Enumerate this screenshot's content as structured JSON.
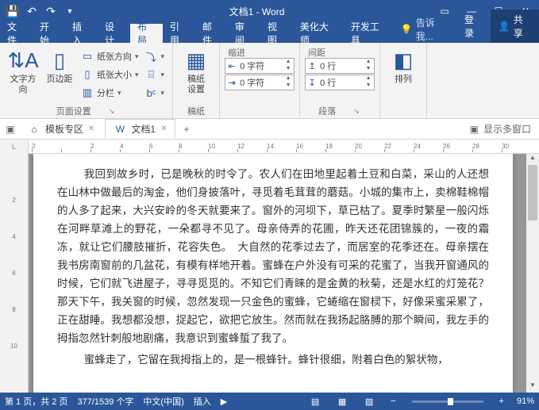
{
  "title": "文档1 - Word",
  "tabs": [
    "文件",
    "开始",
    "插入",
    "设计",
    "布局",
    "引用",
    "邮件",
    "审阅",
    "视图",
    "美化大师",
    "开发工具"
  ],
  "active_tab": 4,
  "tell_me": "告诉我...",
  "login": "登录",
  "share": "共享",
  "ribbon": {
    "text_dir": "文字方向",
    "margins": "页边距",
    "orientation": "纸张方向",
    "size": "纸张大小",
    "columns": "分栏",
    "page_setup_label": "页面设置",
    "writing_settings": "稿纸\n设置",
    "writing_label": "稿纸",
    "indent_label": "缩进",
    "spacing_label": "间距",
    "indent_left": "0 字符",
    "indent_right": "0 字符",
    "spacing_before": "0 行",
    "spacing_after": "0 行",
    "paragraph_label": "段落",
    "arrange": "排列"
  },
  "doc_tabs": {
    "template": "模板专区",
    "doc": "文档1",
    "multi_window": "显示多窗口"
  },
  "ruler_marks": [
    "2",
    "",
    "2",
    "4",
    "6",
    "8",
    "10",
    "12",
    "14",
    "16",
    "18",
    "20",
    "22",
    "24",
    "26",
    "28",
    "30"
  ],
  "vruler_marks": [
    "",
    "2",
    "4",
    "6",
    "8",
    "10"
  ],
  "document": {
    "p1": "我回到故乡时，已是晚秋的时令了。农人们在田地里起着土豆和白菜，采山的人还想在山林中做最后的淘金，他们身披落叶，寻觅着毛茸茸的蘑菇。小城的集市上，卖棉鞋棉帽的人多了起来，大兴安岭的冬天就要来了。窗外的河坝下，草已枯了。夏季时繁星一般闪烁在河畔草滩上的野花，一朵都寻不见了。母亲侍弄的花圃，昨天还花团锦簇的，一夜的霜冻，就让它们腰肢摧折，花容失色。　大自然的花季过去了，而居室的花季还在。母亲摆在我书房南窗前的几盆花，有模有样地开着。蜜蜂在户外没有可采的花蜜了，当我开窗通风的时候，它们就飞进屋子，寻寻觅觅的。不知它们青睐的是金黄的秋菊，还是水红的灯笼花？　那天下午，我关窗的时候，忽然发现一只金色的蜜蜂，它蜷缩在窗棂下，好像采蜜采累了，正在甜睡。我想都没想，捉起它，欲把它放生。然而就在我扬起胳膊的那个瞬间，我左手的拇指忽然针刺般地剧痛，我意识到蜜蜂蜇了我了。",
    "p2": "蜜蜂走了，它留在我拇指上的，是一根蜂针。蜂针很细，附着白色的絮状物，"
  },
  "status": {
    "page": "第 1 页，共 2 页",
    "words": "377/1539 个字",
    "lang": "中文(中国)",
    "insert": "插入",
    "zoom": "91%"
  }
}
